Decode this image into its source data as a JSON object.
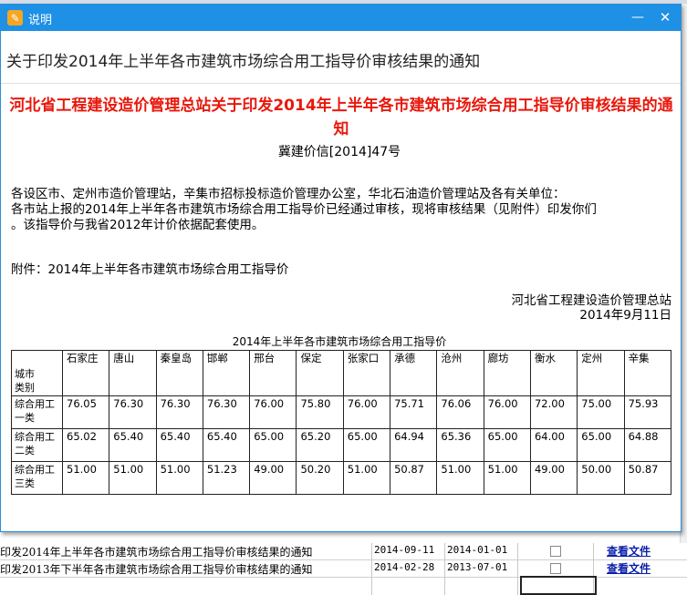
{
  "dialog": {
    "title": "说明",
    "subject": "关于印发2014年上半年各市建筑市场综合用工指导价审核结果的通知",
    "icon": "notice-app-icon",
    "title_bar_color": "#1e90e6"
  },
  "document": {
    "title": "河北省工程建设造价管理总站关于印发2014年上半年各市建筑市场综合用工指导价审核结果的通知",
    "title_color": "#e8180c",
    "number": "冀建价信[2014]47号",
    "body": "各设区市、定州市造价管理站，辛集市招标投标造价管理办公室，华北石油造价管理站及各有关单位：\n各市站上报的2014年上半年各市建筑市场综合用工指导价已经通过审核，现将审核结果（见附件）印发你们\n。该指导价与我省2012年计价依据配套使用。",
    "attachment": "附件：2014年上半年各市建筑市场综合用工指导价",
    "signature_org": "河北省工程建设造价管理总站",
    "signature_date": "2014年9月11日"
  },
  "price_table": {
    "caption": "2014年上半年各市建筑市场综合用工指导价",
    "corner_label": "城市\n类别",
    "cities": [
      "石家庄",
      "唐山",
      "秦皇岛",
      "邯郸",
      "邢台",
      "保定",
      "张家口",
      "承德",
      "沧州",
      "廊坊",
      "衡水",
      "定州",
      "辛集"
    ],
    "rows": [
      {
        "label": "综合用工一类",
        "values": [
          "76.05",
          "76.30",
          "76.30",
          "76.30",
          "76.00",
          "75.80",
          "76.00",
          "75.71",
          "76.06",
          "76.00",
          "72.00",
          "75.00",
          "75.93"
        ]
      },
      {
        "label": "综合用工二类",
        "values": [
          "65.02",
          "65.40",
          "65.40",
          "65.40",
          "65.00",
          "65.20",
          "65.00",
          "64.94",
          "65.36",
          "65.00",
          "64.00",
          "65.00",
          "64.88"
        ]
      },
      {
        "label": "综合用工三类",
        "values": [
          "51.00",
          "51.00",
          "51.00",
          "51.23",
          "49.00",
          "50.20",
          "51.00",
          "50.87",
          "51.00",
          "51.00",
          "49.00",
          "50.00",
          "50.87"
        ]
      }
    ]
  },
  "background_list": {
    "rows": [
      {
        "title": "印发2014年上半年各市建筑市场综合用工指导价审核结果的通知",
        "date1": "2014-09-11",
        "date2": "2014-01-01",
        "link": "查看文件"
      },
      {
        "title": "印发2013年下半年各市建筑市场综合用工指导价审核结果的通知",
        "date1": "2014-02-28",
        "date2": "2013-07-01",
        "link": "查看文件"
      }
    ]
  }
}
